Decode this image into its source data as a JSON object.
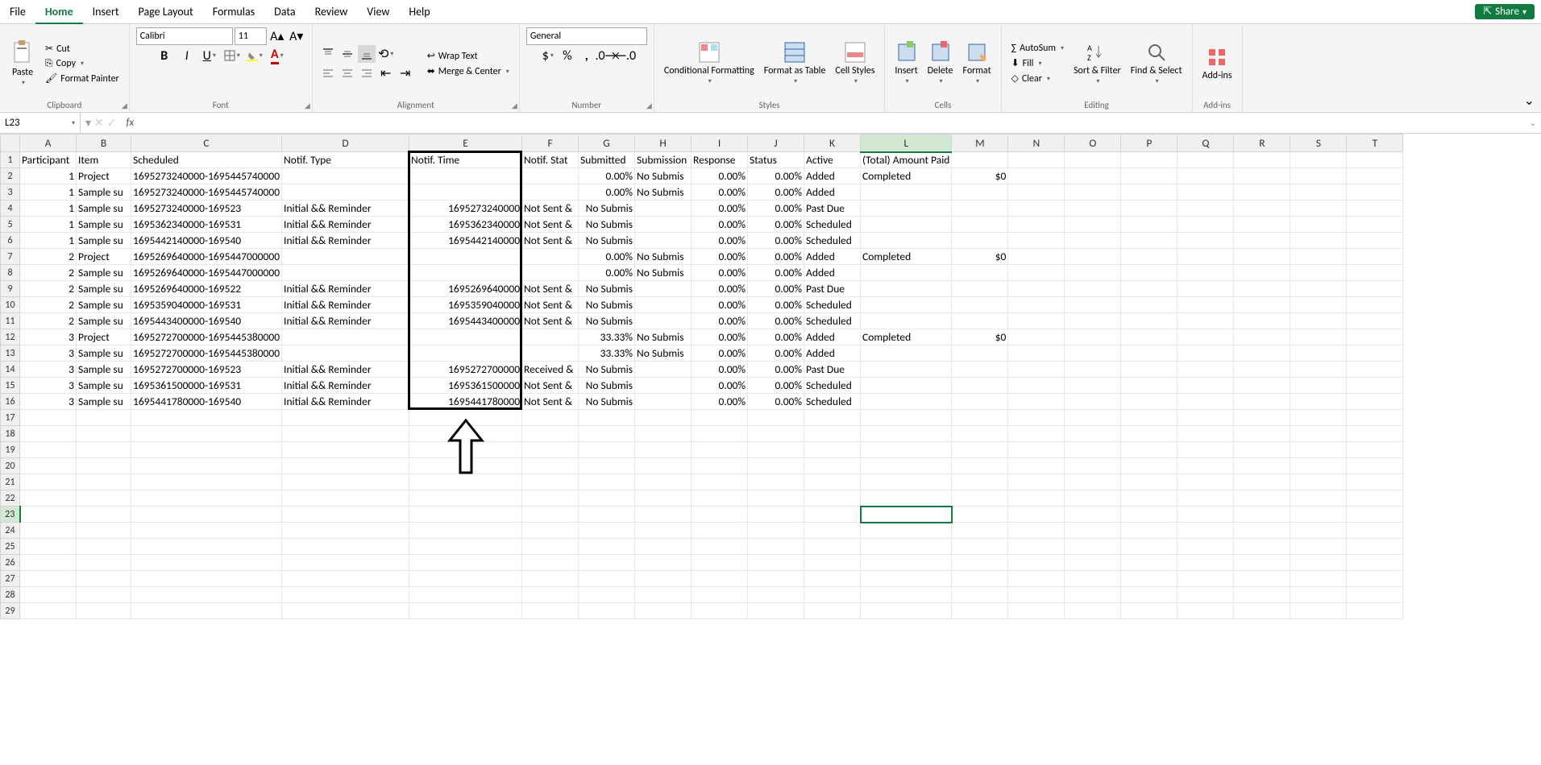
{
  "menu": {
    "items": [
      "File",
      "Home",
      "Insert",
      "Page Layout",
      "Formulas",
      "Data",
      "Review",
      "View",
      "Help"
    ],
    "active": "Home",
    "share": "Share"
  },
  "ribbon": {
    "clipboard": {
      "label": "Clipboard",
      "paste": "Paste",
      "cut": "Cut",
      "copy": "Copy",
      "format_painter": "Format Painter"
    },
    "font": {
      "label": "Font",
      "name": "Calibri",
      "size": "11"
    },
    "alignment": {
      "label": "Alignment",
      "wrap": "Wrap Text",
      "merge": "Merge & Center"
    },
    "number": {
      "label": "Number",
      "format": "General"
    },
    "styles": {
      "label": "Styles",
      "cond": "Conditional Formatting",
      "table": "Format as Table",
      "cell": "Cell Styles"
    },
    "cells": {
      "label": "Cells",
      "insert": "Insert",
      "delete": "Delete",
      "format": "Format"
    },
    "editing": {
      "label": "Editing",
      "autosum": "AutoSum",
      "fill": "Fill",
      "clear": "Clear",
      "sort": "Sort & Filter",
      "find": "Find & Select"
    },
    "addins": {
      "label": "Add-ins",
      "btn": "Add-ins"
    }
  },
  "namebox": "L23",
  "columns": [
    "A",
    "B",
    "C",
    "D",
    "E",
    "F",
    "G",
    "H",
    "I",
    "J",
    "K",
    "L",
    "M",
    "N",
    "O",
    "P",
    "Q",
    "R",
    "S",
    "T"
  ],
  "headers": {
    "A": "Participant",
    "B": "Item",
    "C": "Scheduled",
    "D": "Notif. Type",
    "E": "Notif. Time",
    "F": "Notif. Stat",
    "G": "Submitted",
    "H": "Submission",
    "I": "Response",
    "J": "Status",
    "K": "Active",
    "L": "(Total) Amount Paid"
  },
  "rows": [
    {
      "A": "1",
      "B": "Project",
      "C": "1695273240000-1695445740000",
      "D": "",
      "E": "",
      "F": "",
      "G": "0.00%",
      "H": "No Submis",
      "I": "0.00%",
      "J": "0.00%",
      "K": "Added",
      "L": "Completed",
      "M": "$0"
    },
    {
      "A": "1",
      "B": "Sample su",
      "C": "1695273240000-1695445740000",
      "D": "",
      "E": "",
      "F": "",
      "G": "0.00%",
      "H": "No Submis",
      "I": "0.00%",
      "J": "0.00%",
      "K": "Added",
      "L": "",
      "M": ""
    },
    {
      "A": "1",
      "B": "Sample su",
      "C": "1695273240000-169523",
      "D": "Initial && Reminder",
      "E": "1695273240000",
      "F": "Not Sent &",
      "G": "No Submis",
      "H": "",
      "I": "0.00%",
      "J": "0.00%",
      "K": "Past Due",
      "L": "",
      "M": ""
    },
    {
      "A": "1",
      "B": "Sample su",
      "C": "1695362340000-169531",
      "D": "Initial && Reminder",
      "E": "1695362340000",
      "F": "Not Sent &",
      "G": "No Submis",
      "H": "",
      "I": "0.00%",
      "J": "0.00%",
      "K": "Scheduled",
      "L": "",
      "M": ""
    },
    {
      "A": "1",
      "B": "Sample su",
      "C": "1695442140000-169540",
      "D": "Initial && Reminder",
      "E": "1695442140000",
      "F": "Not Sent &",
      "G": "No Submis",
      "H": "",
      "I": "0.00%",
      "J": "0.00%",
      "K": "Scheduled",
      "L": "",
      "M": ""
    },
    {
      "A": "2",
      "B": "Project",
      "C": "1695269640000-1695447000000",
      "D": "",
      "E": "",
      "F": "",
      "G": "0.00%",
      "H": "No Submis",
      "I": "0.00%",
      "J": "0.00%",
      "K": "Added",
      "L": "Completed",
      "M": "$0"
    },
    {
      "A": "2",
      "B": "Sample su",
      "C": "1695269640000-1695447000000",
      "D": "",
      "E": "",
      "F": "",
      "G": "0.00%",
      "H": "No Submis",
      "I": "0.00%",
      "J": "0.00%",
      "K": "Added",
      "L": "",
      "M": ""
    },
    {
      "A": "2",
      "B": "Sample su",
      "C": "1695269640000-169522",
      "D": "Initial && Reminder",
      "E": "1695269640000",
      "F": "Not Sent &",
      "G": "No Submis",
      "H": "",
      "I": "0.00%",
      "J": "0.00%",
      "K": "Past Due",
      "L": "",
      "M": ""
    },
    {
      "A": "2",
      "B": "Sample su",
      "C": "1695359040000-169531",
      "D": "Initial && Reminder",
      "E": "1695359040000",
      "F": "Not Sent &",
      "G": "No Submis",
      "H": "",
      "I": "0.00%",
      "J": "0.00%",
      "K": "Scheduled",
      "L": "",
      "M": ""
    },
    {
      "A": "2",
      "B": "Sample su",
      "C": "1695443400000-169540",
      "D": "Initial && Reminder",
      "E": "1695443400000",
      "F": "Not Sent &",
      "G": "No Submis",
      "H": "",
      "I": "0.00%",
      "J": "0.00%",
      "K": "Scheduled",
      "L": "",
      "M": ""
    },
    {
      "A": "3",
      "B": "Project",
      "C": "1695272700000-1695445380000",
      "D": "",
      "E": "",
      "F": "",
      "G": "33.33%",
      "H": "No Submis",
      "I": "0.00%",
      "J": "0.00%",
      "K": "Added",
      "L": "Completed",
      "M": "$0"
    },
    {
      "A": "3",
      "B": "Sample su",
      "C": "1695272700000-1695445380000",
      "D": "",
      "E": "",
      "F": "",
      "G": "33.33%",
      "H": "No Submis",
      "I": "0.00%",
      "J": "0.00%",
      "K": "Added",
      "L": "",
      "M": ""
    },
    {
      "A": "3",
      "B": "Sample su",
      "C": "1695272700000-169523",
      "D": "Initial && Reminder",
      "E": "1695272700000",
      "F": "Received &",
      "G": "No Submis",
      "H": "",
      "I": "0.00%",
      "J": "0.00%",
      "K": "Past Due",
      "L": "",
      "M": ""
    },
    {
      "A": "3",
      "B": "Sample su",
      "C": "1695361500000-169531",
      "D": "Initial && Reminder",
      "E": "1695361500000",
      "F": "Not Sent &",
      "G": "No Submis",
      "H": "",
      "I": "0.00%",
      "J": "0.00%",
      "K": "Scheduled",
      "L": "",
      "M": ""
    },
    {
      "A": "3",
      "B": "Sample su",
      "C": "1695441780000-169540",
      "D": "Initial && Reminder",
      "E": "1695441780000",
      "F": "Not Sent &",
      "G": "No Submis",
      "H": "",
      "I": "0.00%",
      "J": "0.00%",
      "K": "Scheduled",
      "L": "",
      "M": ""
    }
  ],
  "empty_rows_from": 17,
  "empty_rows_to": 30,
  "selected_cell": "L23",
  "highlight": {
    "col": "E",
    "row_start": 1,
    "row_end": 16
  }
}
